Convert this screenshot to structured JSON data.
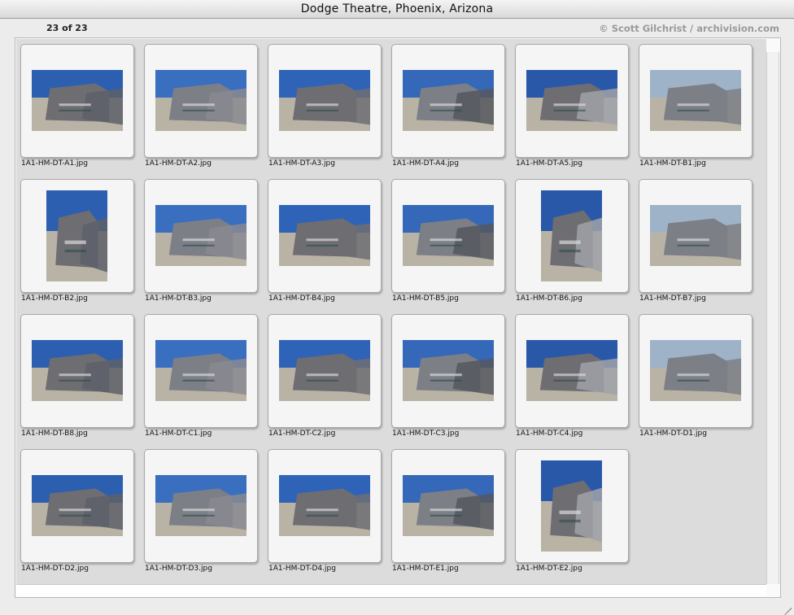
{
  "window": {
    "title": "Dodge Theatre, Phoenix, Arizona"
  },
  "status": {
    "counter": "23 of 23",
    "credit": "© Scott Gilchrist / archivision.com"
  },
  "thumbnails": [
    {
      "filename": "1A1-HM-DT-A1.jpg"
    },
    {
      "filename": "1A1-HM-DT-A2.jpg"
    },
    {
      "filename": "1A1-HM-DT-A3.jpg"
    },
    {
      "filename": "1A1-HM-DT-A4.jpg"
    },
    {
      "filename": "1A1-HM-DT-A5.jpg"
    },
    {
      "filename": "1A1-HM-DT-B1.jpg"
    },
    {
      "filename": "1A1-HM-DT-B2.jpg"
    },
    {
      "filename": "1A1-HM-DT-B3.jpg"
    },
    {
      "filename": "1A1-HM-DT-B4.jpg"
    },
    {
      "filename": "1A1-HM-DT-B5.jpg"
    },
    {
      "filename": "1A1-HM-DT-B6.jpg"
    },
    {
      "filename": "1A1-HM-DT-B7.jpg"
    },
    {
      "filename": "1A1-HM-DT-B8.jpg"
    },
    {
      "filename": "1A1-HM-DT-C1.jpg"
    },
    {
      "filename": "1A1-HM-DT-C2.jpg"
    },
    {
      "filename": "1A1-HM-DT-C3.jpg"
    },
    {
      "filename": "1A1-HM-DT-C4.jpg"
    },
    {
      "filename": "1A1-HM-DT-D1.jpg"
    },
    {
      "filename": "1A1-HM-DT-D2.jpg"
    },
    {
      "filename": "1A1-HM-DT-D3.jpg"
    },
    {
      "filename": "1A1-HM-DT-D4.jpg"
    },
    {
      "filename": "1A1-HM-DT-E1.jpg"
    },
    {
      "filename": "1A1-HM-DT-E2.jpg"
    }
  ]
}
